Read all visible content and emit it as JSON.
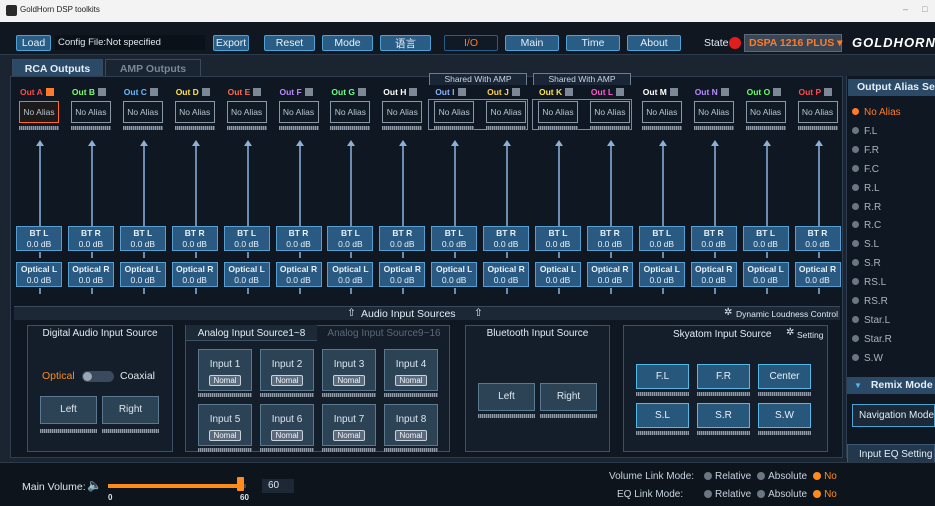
{
  "window": {
    "title": "GoldHorn DSP toolkits",
    "minimize": "–",
    "maximize": "□"
  },
  "toolbar": {
    "load": "Load",
    "config_file": "Config File:Not specified",
    "export": "Export",
    "reset": "Reset",
    "mode": "Mode",
    "language": "语言",
    "tabs": [
      "I/O",
      "Main",
      "Time",
      "About"
    ],
    "active_tab": "I/O",
    "state_label": "State",
    "state_color": "#e31d1d",
    "device": "DSPA 1216 PLUS ▾",
    "brand": "GOLDHORN"
  },
  "subtabs": [
    "RCA Outputs",
    "AMP Outputs"
  ],
  "shared_label": "Shared With AMP",
  "outputs": [
    {
      "label": "Out A",
      "alias": "No Alias",
      "color": "#ff4a4a",
      "checked": true,
      "bt": "BT L",
      "bt_val": "0.0 dB",
      "opt": "Optical L",
      "opt_val": "0.0 dB"
    },
    {
      "label": "Out B",
      "alias": "No Alias",
      "color": "#7cff6a",
      "checked": false,
      "bt": "BT R",
      "bt_val": "0.0 dB",
      "opt": "Optical R",
      "opt_val": "0.0 dB"
    },
    {
      "label": "Out C",
      "alias": "No Alias",
      "color": "#6ab8ff",
      "checked": false,
      "bt": "BT L",
      "bt_val": "0.0 dB",
      "opt": "Optical L",
      "opt_val": "0.0 dB"
    },
    {
      "label": "Out D",
      "alias": "No Alias",
      "color": "#ffe24a",
      "checked": false,
      "bt": "BT R",
      "bt_val": "0.0 dB",
      "opt": "Optical R",
      "opt_val": "0.0 dB"
    },
    {
      "label": "Out E",
      "alias": "No Alias",
      "color": "#ff6a4a",
      "checked": false,
      "bt": "BT L",
      "bt_val": "0.0 dB",
      "opt": "Optical L",
      "opt_val": "0.0 dB"
    },
    {
      "label": "Out F",
      "alias": "No Alias",
      "color": "#b88aff",
      "checked": false,
      "bt": "BT R",
      "bt_val": "0.0 dB",
      "opt": "Optical R",
      "opt_val": "0.0 dB"
    },
    {
      "label": "Out G",
      "alias": "No Alias",
      "color": "#6aff8a",
      "checked": false,
      "bt": "BT L",
      "bt_val": "0.0 dB",
      "opt": "Optical L",
      "opt_val": "0.0 dB"
    },
    {
      "label": "Out H",
      "alias": "No Alias",
      "color": "#ffffff",
      "checked": false,
      "bt": "BT R",
      "bt_val": "0.0 dB",
      "opt": "Optical R",
      "opt_val": "0.0 dB"
    },
    {
      "label": "Out I",
      "alias": "No Alias",
      "color": "#8ab0ff",
      "checked": false,
      "bt": "BT L",
      "bt_val": "0.0 dB",
      "opt": "Optical L",
      "opt_val": "0.0 dB"
    },
    {
      "label": "Out J",
      "alias": "No Alias",
      "color": "#ffd24a",
      "checked": false,
      "bt": "BT R",
      "bt_val": "0.0 dB",
      "opt": "Optical R",
      "opt_val": "0.0 dB"
    },
    {
      "label": "Out K",
      "alias": "No Alias",
      "color": "#ffe24a",
      "checked": false,
      "bt": "BT L",
      "bt_val": "0.0 dB",
      "opt": "Optical L",
      "opt_val": "0.0 dB"
    },
    {
      "label": "Out L",
      "alias": "No Alias",
      "color": "#ff5ad2",
      "checked": false,
      "bt": "BT R",
      "bt_val": "0.0 dB",
      "opt": "Optical R",
      "opt_val": "0.0 dB"
    },
    {
      "label": "Out M",
      "alias": "No Alias",
      "color": "#ffffff",
      "checked": false,
      "bt": "BT L",
      "bt_val": "0.0 dB",
      "opt": "Optical L",
      "opt_val": "0.0 dB"
    },
    {
      "label": "Out N",
      "alias": "No Alias",
      "color": "#b88aff",
      "checked": false,
      "bt": "BT R",
      "bt_val": "0.0 dB",
      "opt": "Optical R",
      "opt_val": "0.0 dB"
    },
    {
      "label": "Out O",
      "alias": "No Alias",
      "color": "#6aff6a",
      "checked": false,
      "bt": "BT L",
      "bt_val": "0.0 dB",
      "opt": "Optical L",
      "opt_val": "0.0 dB"
    },
    {
      "label": "Out P",
      "alias": "No Alias",
      "color": "#ff4a4a",
      "checked": false,
      "bt": "BT R",
      "bt_val": "0.0 dB",
      "opt": "Optical R",
      "opt_val": "0.0 dB"
    }
  ],
  "audio_sources": {
    "title": "Audio Input Sources",
    "dynamic": "Dynamic Loudness Control",
    "digital": {
      "title": "Digital Audio Input Source",
      "optical": "Optical",
      "coaxial": "Coaxial",
      "left": "Left",
      "right": "Right"
    },
    "analog": {
      "title": "Analog Input Source1~8",
      "title2": "Analog Input Source9~16",
      "inputs": [
        "Input 1",
        "Input 2",
        "Input 3",
        "Input 4",
        "Input 5",
        "Input 6",
        "Input 7",
        "Input 8"
      ],
      "mode": "Nomal"
    },
    "bluetooth": {
      "title": "Bluetooth Input Source",
      "left": "Left",
      "right": "Right"
    },
    "skyatom": {
      "title": "Skyatom Input Source",
      "setting": "Setting",
      "buttons": [
        "F.L",
        "F.R",
        "Center",
        "S.L",
        "S.R",
        "S.W"
      ]
    }
  },
  "sidebar": {
    "title": "Output Alias Setting",
    "items": [
      "No Alias",
      "F.L",
      "F.R",
      "F.C",
      "R.L",
      "R.R",
      "R.C",
      "S.L",
      "S.R",
      "RS.L",
      "RS.R",
      "Star.L",
      "Star.R",
      "S.W"
    ],
    "selected": "No Alias",
    "remix_title": "Remix Mode",
    "remix_value": "Navigation Mode",
    "input_eq": "Input EQ Setting"
  },
  "bottom": {
    "main_volume": "Main Volume:",
    "vol_min": "0",
    "vol_max": "60",
    "vol_value": "60",
    "vol_level": 1.0,
    "volume_link": "Volume Link Mode:",
    "eq_link": "EQ Link Mode:",
    "options": [
      "Relative",
      "Absolute",
      "No"
    ],
    "selected": "No"
  }
}
